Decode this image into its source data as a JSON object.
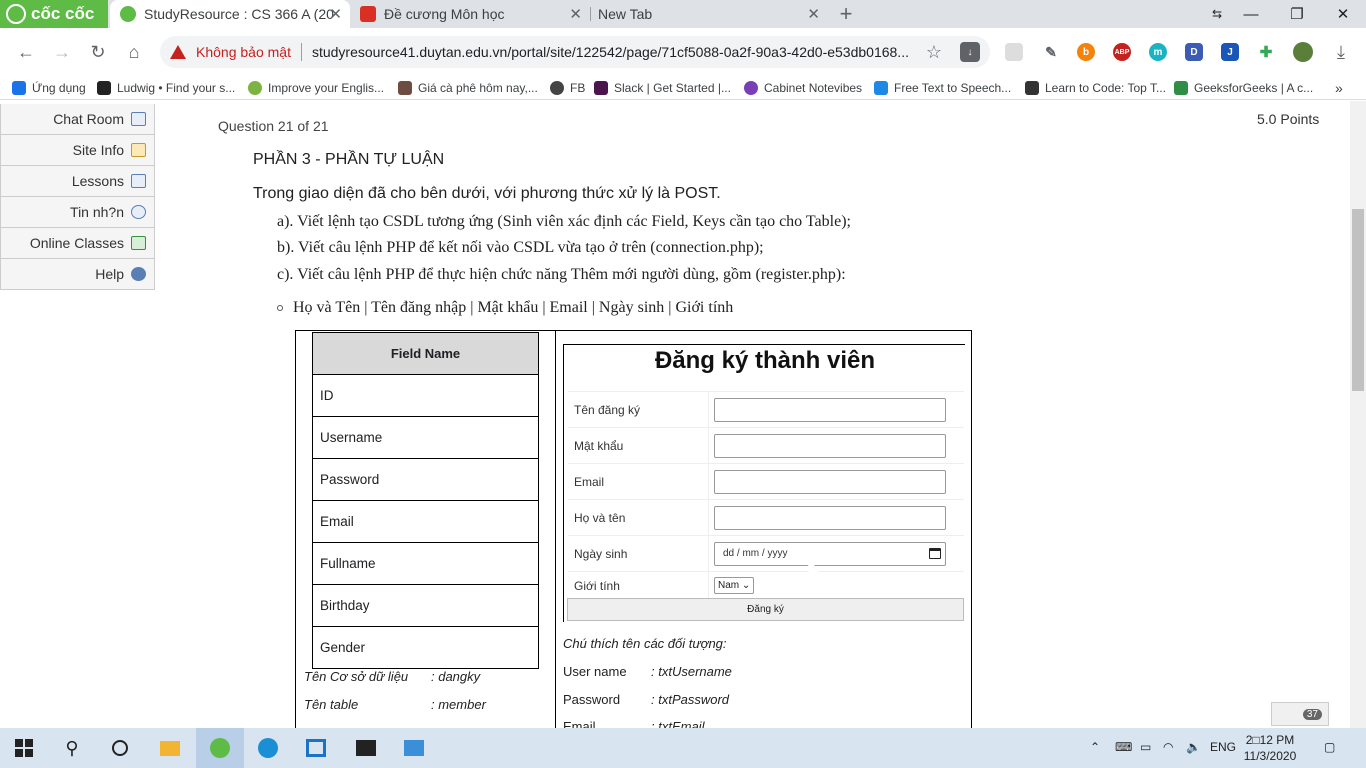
{
  "browser": {
    "brand": "cốc cốc",
    "tabs": [
      {
        "title": "StudyResource : CS 366 A (20",
        "active": true
      },
      {
        "title": "Đề cương Môn học",
        "active": false
      },
      {
        "title": "New Tab",
        "active": false
      }
    ],
    "security_label": "Không bảo mật",
    "url": "studyresource41.duytan.edu.vn/portal/site/122542/page/71cf5088-0a2f-90a3-42d0-e53db0168...",
    "bookmarks": [
      "Ứng dụng",
      "Ludwig • Find your s...",
      "Improve your Englis...",
      "Giá cà phê hôm nay,...",
      "FB",
      "Slack | Get Started |...",
      "Cabinet Notevibes",
      "Free Text to Speech...",
      "Learn to Code: Top T...",
      "GeeksforGeeks | A c..."
    ],
    "more_bookmarks": "»"
  },
  "sidebar": {
    "items": [
      {
        "label": "Chat Room",
        "icon": "chat-icon"
      },
      {
        "label": "Site Info",
        "icon": "info-icon"
      },
      {
        "label": "Lessons",
        "icon": "book-icon"
      },
      {
        "label": "Tin nh?n",
        "icon": "message-icon"
      },
      {
        "label": "Online Classes",
        "icon": "classes-icon"
      },
      {
        "label": "Help",
        "icon": "help-icon"
      }
    ]
  },
  "question": {
    "number": "Question 21 of 21",
    "points": "5.0 Points",
    "heading": "PHẦN 3 - PHẦN TỰ LUẬN",
    "intro": "Trong giao diện đã cho bên dưới, với phương thức xử lý là POST.",
    "requirements": [
      "a). Viết lệnh tạo CSDL tương ứng (Sinh viên xác định các Field, Keys cần tạo cho Table);",
      "b). Viết câu lệnh PHP để kết nối vào CSDL vừa tạo ở trên (connection.php);",
      "c). Viết câu lệnh PHP để thực hiện chức năng Thêm mới người dùng, gồm (register.php):"
    ],
    "bullet": "Họ và Tên | Tên đăng nhập | Mật khẩu | Email | Ngày sinh | Giới tính"
  },
  "field_table": {
    "header": "Field Name",
    "rows": [
      "ID",
      "Username",
      "Password",
      "Email",
      "Fullname",
      "Birthday",
      "Gender"
    ]
  },
  "db_notes": [
    {
      "label": "Tên Cơ sở dữ liệu",
      "value": ": dangky"
    },
    {
      "label": "Tên table",
      "value": ": member"
    }
  ],
  "form": {
    "title": "Đăng ký thành viên",
    "fields": [
      {
        "label": "Tên đăng ký",
        "value": ""
      },
      {
        "label": "Mật khẩu",
        "value": ""
      },
      {
        "label": "Email",
        "value": ""
      },
      {
        "label": "Họ và tên",
        "value": ""
      },
      {
        "label": "Ngày sinh",
        "value": "dd / mm / yyyy"
      }
    ],
    "gender_label": "Giới tính",
    "gender_value": "Nam",
    "submit": "Đăng ký"
  },
  "object_notes": {
    "title": "Chú thích tên các đối tượng:",
    "items": [
      {
        "label": "User name",
        "value": ": txtUsername"
      },
      {
        "label": "Password",
        "value": ": txtPassword"
      },
      {
        "label": "Email",
        "value": ": txtEmail"
      }
    ]
  },
  "floating_badge": "37",
  "taskbar": {
    "language": "ENG",
    "time": "2□12 PM",
    "date": "11/3/2020"
  }
}
